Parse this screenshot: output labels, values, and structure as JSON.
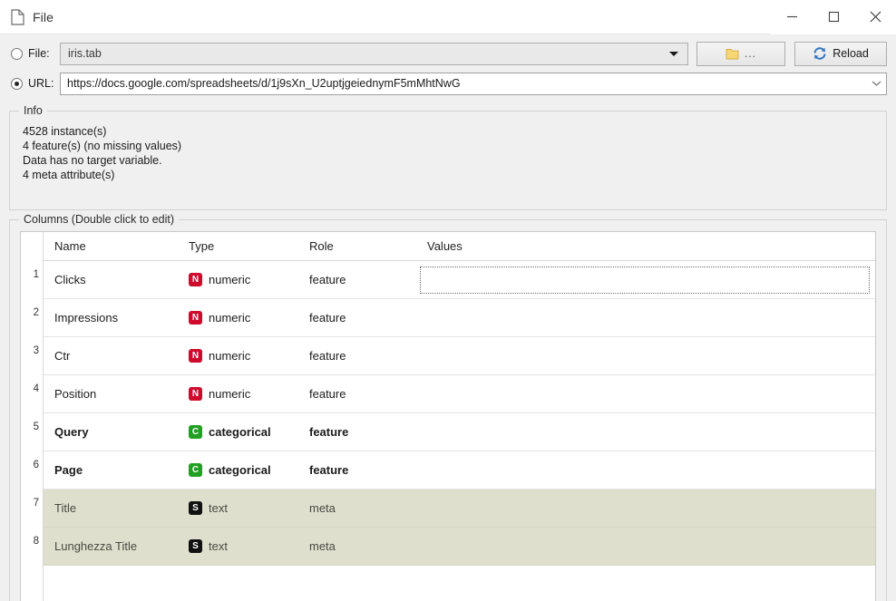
{
  "window": {
    "title": "File",
    "title_icon": "document-icon",
    "controls": {
      "minimize": "minimize-icon",
      "maximize": "maximize-icon",
      "close": "close-icon"
    }
  },
  "source": {
    "file": {
      "radio_label": "File:",
      "selected": false,
      "value": "iris.tab",
      "dropdown_icon": "triangle-down-icon"
    },
    "url": {
      "radio_label": "URL:",
      "selected": true,
      "value": "https://docs.google.com/spreadsheets/d/1j9sXn_U2uptjgeiednymF5mMhtNwG",
      "dropdown_icon": "chevron-down-icon"
    },
    "browse_button": {
      "label": "...",
      "icon": "folder-icon"
    },
    "reload_button": {
      "label": "Reload",
      "icon": "reload-icon"
    }
  },
  "info": {
    "title": "Info",
    "lines": [
      "4528 instance(s)",
      "4 feature(s) (no missing values)",
      "Data has no target variable.",
      "4 meta attribute(s)"
    ]
  },
  "columns": {
    "title": "Columns (Double click to edit)",
    "headers": [
      "Name",
      "Type",
      "Role",
      "Values"
    ],
    "rows": [
      {
        "index": "1",
        "name": "Clicks",
        "type": "numeric",
        "type_badge": "N",
        "role": "feature",
        "values": "",
        "style": "normal",
        "values_focused": true
      },
      {
        "index": "2",
        "name": "Impressions",
        "type": "numeric",
        "type_badge": "N",
        "role": "feature",
        "values": "",
        "style": "normal",
        "values_focused": false
      },
      {
        "index": "3",
        "name": "Ctr",
        "type": "numeric",
        "type_badge": "N",
        "role": "feature",
        "values": "",
        "style": "normal",
        "values_focused": false
      },
      {
        "index": "4",
        "name": "Position",
        "type": "numeric",
        "type_badge": "N",
        "role": "feature",
        "values": "",
        "style": "normal",
        "values_focused": false
      },
      {
        "index": "5",
        "name": "Query",
        "type": "categorical",
        "type_badge": "C",
        "role": "feature",
        "values": "",
        "style": "bold",
        "values_focused": false
      },
      {
        "index": "6",
        "name": "Page",
        "type": "categorical",
        "type_badge": "C",
        "role": "feature",
        "values": "",
        "style": "bold",
        "values_focused": false
      },
      {
        "index": "7",
        "name": "Title",
        "type": "text",
        "type_badge": "S",
        "role": "meta",
        "values": "",
        "style": "meta",
        "values_focused": false
      },
      {
        "index": "8",
        "name": "Lunghezza Title",
        "type": "text",
        "type_badge": "S",
        "role": "meta",
        "values": "",
        "style": "meta",
        "values_focused": false
      }
    ]
  },
  "colors": {
    "numeric_badge": "#cf0a2c",
    "categorical_badge": "#22a024",
    "text_badge": "#111111",
    "meta_row_bg": "#dedfcd",
    "window_bg": "#f0f0f0"
  }
}
